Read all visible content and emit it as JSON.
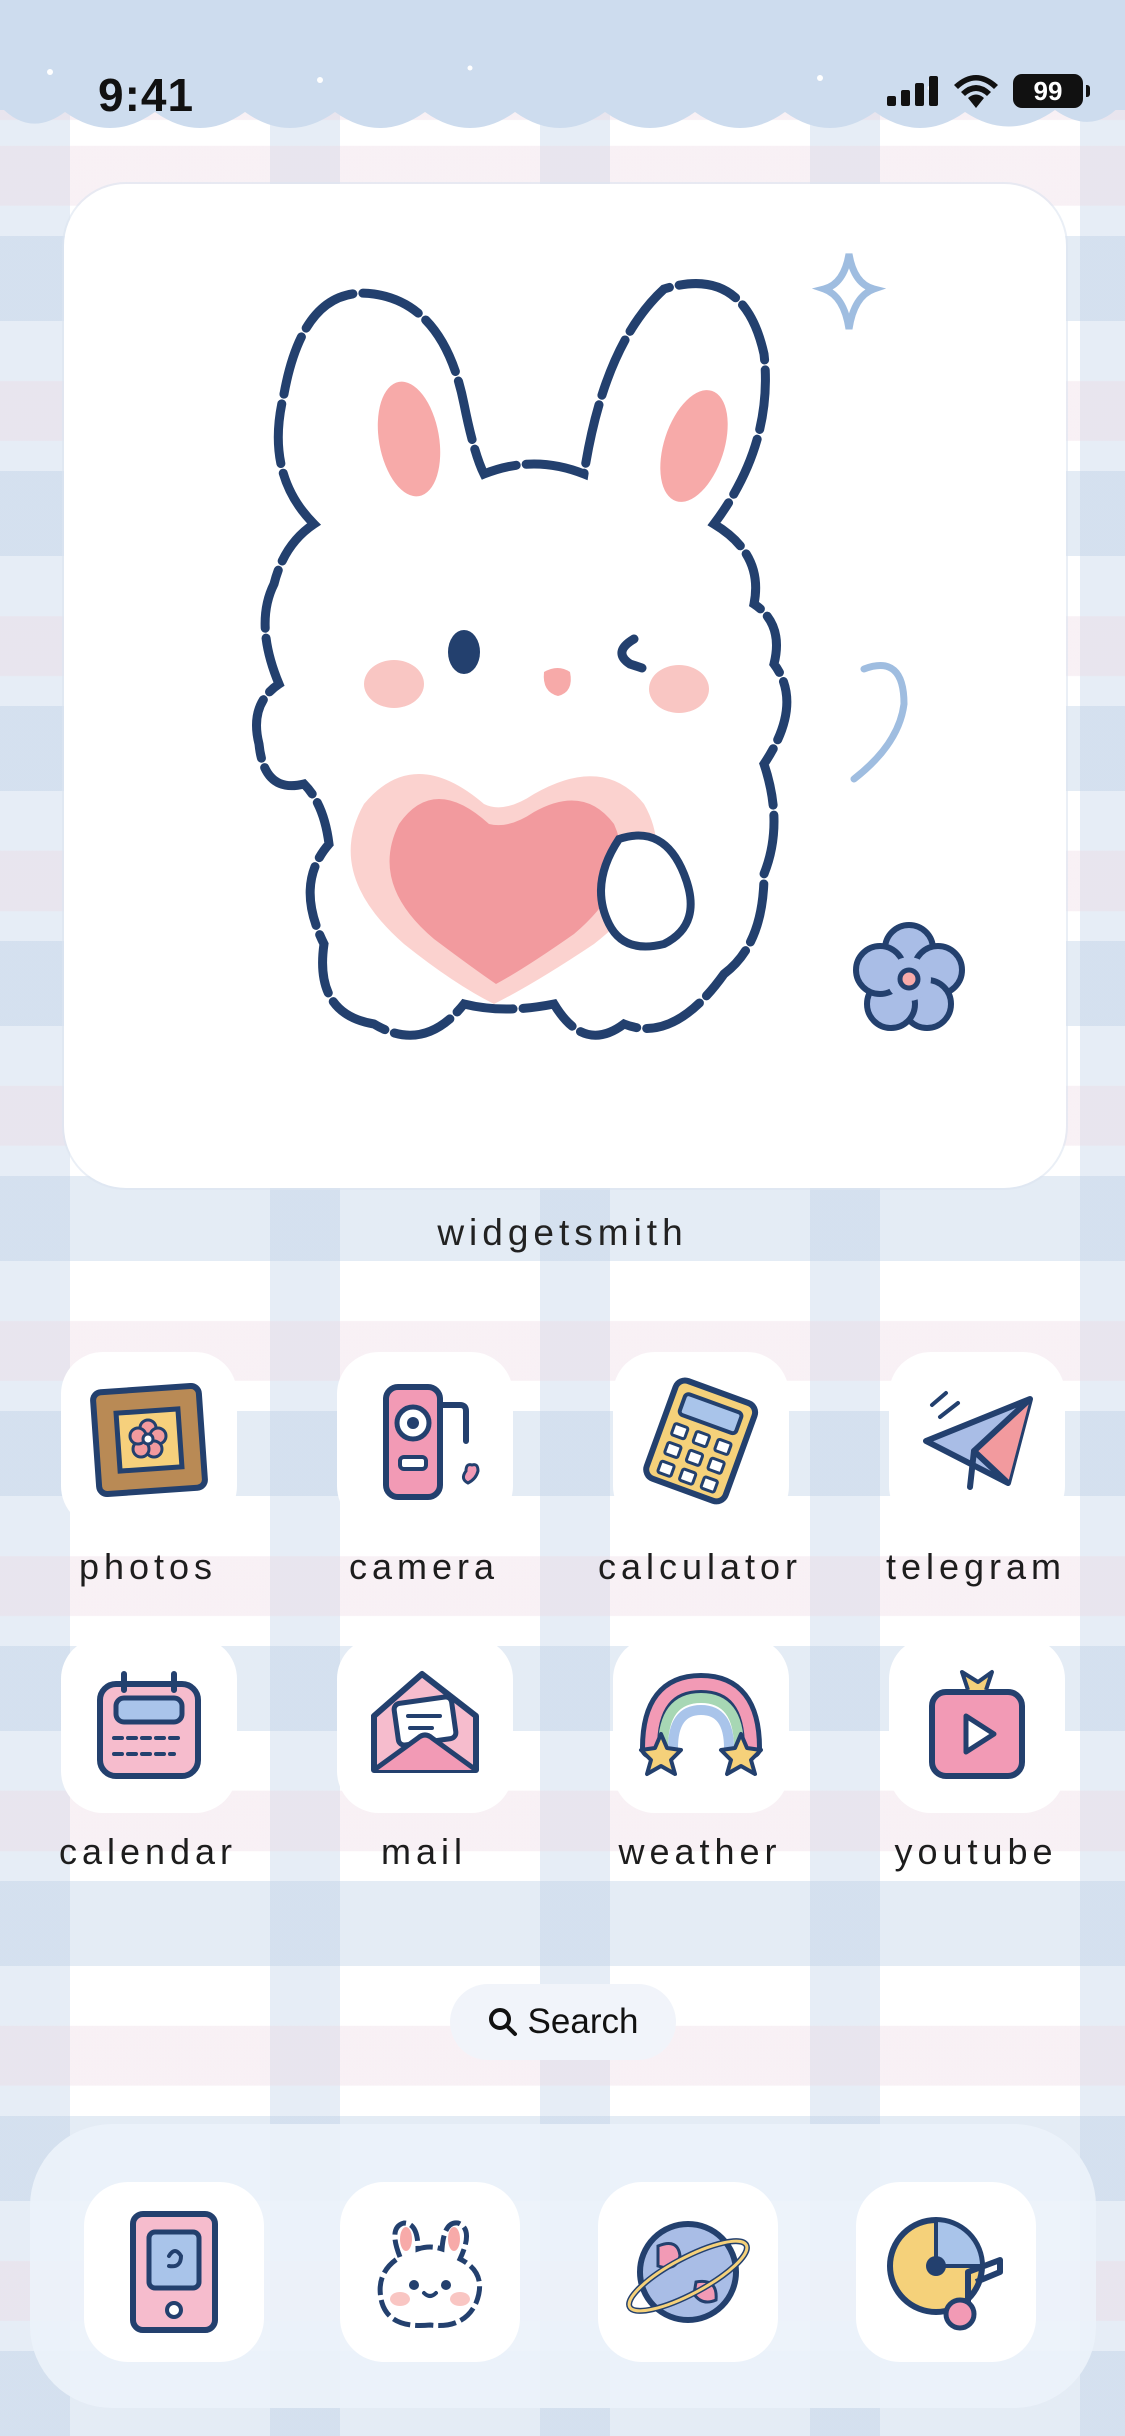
{
  "status_bar": {
    "time": "9:41",
    "battery": "99"
  },
  "widget": {
    "label": "widgetsmith",
    "image": "bunny-holding-heart-illustration"
  },
  "apps": [
    {
      "label": "photos",
      "icon": "photos-icon"
    },
    {
      "label": "camera",
      "icon": "camera-icon"
    },
    {
      "label": "calculator",
      "icon": "calculator-icon"
    },
    {
      "label": "telegram",
      "icon": "telegram-icon"
    },
    {
      "label": "calendar",
      "icon": "calendar-icon"
    },
    {
      "label": "mail",
      "icon": "mail-icon"
    },
    {
      "label": "weather",
      "icon": "weather-icon"
    },
    {
      "label": "youtube",
      "icon": "youtube-icon"
    }
  ],
  "search": {
    "label": "Search"
  },
  "dock": [
    {
      "icon": "phone-icon"
    },
    {
      "icon": "bunny-face-icon"
    },
    {
      "icon": "planet-icon"
    },
    {
      "icon": "music-icon"
    }
  ],
  "colors": {
    "outline": "#23406e",
    "pink": "#f29a9e",
    "light_blue": "#cddcee",
    "yellow": "#f5d17a"
  }
}
